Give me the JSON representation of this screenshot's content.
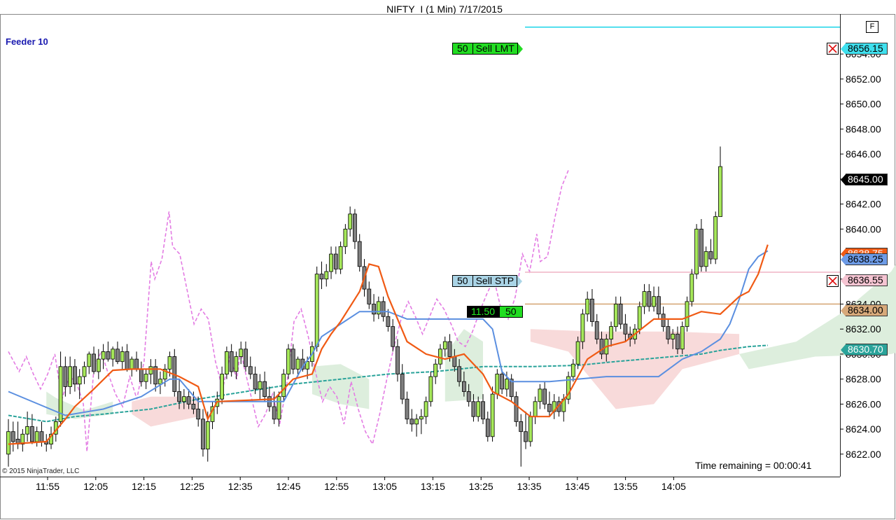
{
  "window": {
    "title": "NIFTY_I (1 Min)  7/17/2015",
    "f_button": "F",
    "feeder": "Feeder 10",
    "copyright": "© 2015 NinjaTrader, LLC",
    "time_remaining": "Time remaining = 00:00:41"
  },
  "orders": {
    "limit": {
      "qty": "50",
      "label": "Sell LMT",
      "price": "8656.15"
    },
    "stop": {
      "qty": "50",
      "label": "Sell STP",
      "price": "8636.55"
    }
  },
  "position": {
    "pnl": "11.50",
    "qty": "50",
    "entry_price": "8634.00"
  },
  "price_labels": {
    "last": "8645.00",
    "orange": "8638.75",
    "blue": "8638.25",
    "teal": "8630.70"
  },
  "colors": {
    "up_candle": "#a6e85a",
    "down_candle": "#808080",
    "limit_line": "#1ad4e8",
    "stop_line": "#f0b8c8",
    "entry_line": "#d7a97a",
    "orange_line": "#f05a14",
    "blue_line": "#5b8fe0",
    "teal_line": "#2aa39a",
    "magenta_line": "#e37ce3"
  },
  "chart_data": {
    "type": "candlestick",
    "x_ticks": [
      "11:55",
      "12:05",
      "12:15",
      "12:25",
      "12:35",
      "12:45",
      "12:55",
      "13:05",
      "13:15",
      "13:25",
      "13:35",
      "13:45",
      "13:55",
      "14:05"
    ],
    "y_ticks": [
      "8622.00",
      "8624.00",
      "8626.00",
      "8628.00",
      "8630.00",
      "8632.00",
      "8634.00",
      "8636.00",
      "8638.00",
      "8640.00",
      "8642.00",
      "8644.00",
      "8646.00",
      "8648.00",
      "8650.00",
      "8652.00",
      "8654.00"
    ],
    "ylim": [
      8620.2,
      8657.2
    ],
    "candles": [
      [
        8622.0,
        8624.8,
        8621.0,
        8623.8
      ],
      [
        8623.8,
        8624.6,
        8622.2,
        8623.0
      ],
      [
        8623.2,
        8624.6,
        8622.4,
        8622.8
      ],
      [
        8622.8,
        8624.0,
        8622.2,
        8623.6
      ],
      [
        8623.6,
        8625.4,
        8623.0,
        8624.2
      ],
      [
        8624.2,
        8625.2,
        8622.8,
        8623.0
      ],
      [
        8623.0,
        8624.2,
        8622.6,
        8623.8
      ],
      [
        8623.8,
        8624.6,
        8622.6,
        8623.0
      ],
      [
        8623.0,
        8623.6,
        8622.2,
        8622.8
      ],
      [
        8622.8,
        8624.2,
        8622.4,
        8623.6
      ],
      [
        8623.6,
        8625.0,
        8623.0,
        8624.6
      ],
      [
        8624.6,
        8630.2,
        8624.2,
        8629.0
      ],
      [
        8629.0,
        8629.8,
        8626.6,
        8627.4
      ],
      [
        8627.4,
        8629.8,
        8626.8,
        8629.0
      ],
      [
        8629.0,
        8629.6,
        8627.0,
        8627.6
      ],
      [
        8627.6,
        8628.8,
        8626.4,
        8628.2
      ],
      [
        8628.2,
        8629.4,
        8627.6,
        8629.0
      ],
      [
        8629.0,
        8630.2,
        8628.4,
        8630.0
      ],
      [
        8630.0,
        8630.6,
        8628.4,
        8628.6
      ],
      [
        8628.6,
        8630.4,
        8628.0,
        8629.6
      ],
      [
        8629.6,
        8630.8,
        8628.8,
        8630.2
      ],
      [
        8630.2,
        8631.0,
        8629.4,
        8629.6
      ],
      [
        8629.6,
        8630.6,
        8629.0,
        8630.4
      ],
      [
        8630.4,
        8631.0,
        8629.2,
        8629.4
      ],
      [
        8629.4,
        8630.6,
        8628.8,
        8630.2
      ],
      [
        8630.2,
        8630.8,
        8628.6,
        8628.8
      ],
      [
        8628.8,
        8629.8,
        8628.2,
        8629.6
      ],
      [
        8629.6,
        8630.2,
        8628.6,
        8628.8
      ],
      [
        8628.8,
        8629.4,
        8627.4,
        8627.8
      ],
      [
        8627.8,
        8628.8,
        8627.2,
        8628.4
      ],
      [
        8628.4,
        8629.6,
        8627.6,
        8629.0
      ],
      [
        8629.0,
        8629.6,
        8627.0,
        8627.6
      ],
      [
        8627.6,
        8628.6,
        8626.8,
        8628.0
      ],
      [
        8628.0,
        8629.2,
        8627.4,
        8628.8
      ],
      [
        8628.8,
        8630.2,
        8628.2,
        8629.8
      ],
      [
        8629.8,
        8630.4,
        8626.6,
        8627.0
      ],
      [
        8627.0,
        8628.0,
        8625.6,
        8626.2
      ],
      [
        8626.2,
        8627.2,
        8625.6,
        8626.6
      ],
      [
        8626.6,
        8627.2,
        8625.6,
        8626.0
      ],
      [
        8626.0,
        8627.0,
        8625.2,
        8625.6
      ],
      [
        8625.6,
        8626.6,
        8624.2,
        8624.8
      ],
      [
        8624.8,
        8625.6,
        8621.8,
        8622.4
      ],
      [
        8622.4,
        8625.4,
        8621.4,
        8624.6
      ],
      [
        8624.6,
        8626.2,
        8624.0,
        8625.8
      ],
      [
        8625.8,
        8627.0,
        8625.2,
        8626.4
      ],
      [
        8626.4,
        8629.0,
        8626.0,
        8628.4
      ],
      [
        8628.4,
        8630.6,
        8628.0,
        8630.2
      ],
      [
        8630.2,
        8630.8,
        8628.2,
        8628.6
      ],
      [
        8628.6,
        8630.2,
        8628.0,
        8629.8
      ],
      [
        8629.8,
        8631.0,
        8629.2,
        8630.4
      ],
      [
        8630.4,
        8631.0,
        8628.6,
        8629.0
      ],
      [
        8629.0,
        8629.8,
        8628.0,
        8628.4
      ],
      [
        8628.4,
        8629.0,
        8626.8,
        8627.2
      ],
      [
        8627.2,
        8628.4,
        8626.4,
        8627.8
      ],
      [
        8627.8,
        8628.6,
        8626.2,
        8626.6
      ],
      [
        8626.6,
        8627.4,
        8625.4,
        8625.8
      ],
      [
        8625.8,
        8627.0,
        8624.4,
        8624.8
      ],
      [
        8624.8,
        8627.0,
        8624.2,
        8626.6
      ],
      [
        8626.6,
        8628.8,
        8626.2,
        8628.4
      ],
      [
        8628.4,
        8630.8,
        8628.0,
        8630.4
      ],
      [
        8630.4,
        8630.8,
        8628.4,
        8628.8
      ],
      [
        8628.8,
        8629.8,
        8628.2,
        8629.6
      ],
      [
        8629.6,
        8630.4,
        8628.6,
        8628.8
      ],
      [
        8628.8,
        8629.8,
        8628.0,
        8629.4
      ],
      [
        8629.4,
        8631.0,
        8629.0,
        8630.6
      ],
      [
        8630.6,
        8637.0,
        8630.2,
        8636.4
      ],
      [
        8636.4,
        8637.4,
        8635.2,
        8636.0
      ],
      [
        8636.0,
        8637.2,
        8635.4,
        8636.6
      ],
      [
        8636.6,
        8638.6,
        8636.0,
        8638.0
      ],
      [
        8638.0,
        8638.6,
        8636.4,
        8636.8
      ],
      [
        8636.8,
        8639.0,
        8636.4,
        8638.6
      ],
      [
        8638.6,
        8640.4,
        8638.0,
        8640.0
      ],
      [
        8640.0,
        8641.8,
        8639.4,
        8641.2
      ],
      [
        8641.2,
        8641.6,
        8638.4,
        8639.0
      ],
      [
        8639.0,
        8639.6,
        8636.6,
        8637.0
      ],
      [
        8637.0,
        8637.6,
        8634.6,
        8635.2
      ],
      [
        8635.2,
        8635.8,
        8633.6,
        8634.0
      ],
      [
        8634.0,
        8634.8,
        8632.6,
        8633.2
      ],
      [
        8633.2,
        8634.6,
        8632.8,
        8634.2
      ],
      [
        8634.2,
        8634.6,
        8632.6,
        8633.0
      ],
      [
        8633.0,
        8633.6,
        8631.8,
        8632.2
      ],
      [
        8632.2,
        8632.8,
        8630.2,
        8630.6
      ],
      [
        8630.6,
        8631.2,
        8627.8,
        8628.4
      ],
      [
        8628.4,
        8629.2,
        8626.0,
        8626.4
      ],
      [
        8626.4,
        8627.0,
        8624.4,
        8624.8
      ],
      [
        8624.8,
        8625.6,
        8623.8,
        8624.4
      ],
      [
        8624.4,
        8625.2,
        8623.4,
        8624.8
      ],
      [
        8624.8,
        8625.6,
        8623.6,
        8625.0
      ],
      [
        8625.0,
        8626.6,
        8624.4,
        8626.2
      ],
      [
        8626.2,
        8628.6,
        8625.8,
        8628.2
      ],
      [
        8628.2,
        8629.6,
        8627.6,
        8629.2
      ],
      [
        8629.2,
        8630.8,
        8628.8,
        8630.4
      ],
      [
        8630.4,
        8631.4,
        8629.8,
        8631.0
      ],
      [
        8631.0,
        8631.6,
        8629.4,
        8629.8
      ],
      [
        8629.8,
        8630.4,
        8628.6,
        8629.0
      ],
      [
        8629.0,
        8629.6,
        8627.4,
        8627.8
      ],
      [
        8627.8,
        8628.6,
        8626.6,
        8627.0
      ],
      [
        8627.0,
        8627.6,
        8625.8,
        8626.2
      ],
      [
        8626.2,
        8626.8,
        8624.6,
        8625.0
      ],
      [
        8625.0,
        8626.6,
        8624.6,
        8626.2
      ],
      [
        8626.2,
        8626.8,
        8624.4,
        8624.8
      ],
      [
        8624.8,
        8625.4,
        8623.0,
        8623.4
      ],
      [
        8623.4,
        8627.4,
        8623.0,
        8626.8
      ],
      [
        8626.8,
        8628.8,
        8626.4,
        8628.4
      ],
      [
        8628.4,
        8628.8,
        8626.8,
        8627.2
      ],
      [
        8627.2,
        8628.6,
        8626.6,
        8628.0
      ],
      [
        8628.0,
        8628.4,
        8626.2,
        8626.6
      ],
      [
        8626.6,
        8627.0,
        8624.2,
        8624.6
      ],
      [
        8624.6,
        8625.2,
        8621.0,
        8623.8
      ],
      [
        8623.8,
        8625.4,
        8622.4,
        8623.0
      ],
      [
        8623.0,
        8625.4,
        8622.6,
        8625.0
      ],
      [
        8625.0,
        8626.6,
        8624.4,
        8626.2
      ],
      [
        8626.2,
        8627.6,
        8625.6,
        8627.2
      ],
      [
        8627.2,
        8627.8,
        8625.6,
        8626.0
      ],
      [
        8626.0,
        8627.0,
        8625.0,
        8625.4
      ],
      [
        8625.4,
        8626.8,
        8624.8,
        8626.2
      ],
      [
        8626.2,
        8626.6,
        8625.0,
        8625.4
      ],
      [
        8625.4,
        8626.8,
        8624.6,
        8626.4
      ],
      [
        8626.4,
        8628.6,
        8626.0,
        8628.2
      ],
      [
        8628.2,
        8629.6,
        8627.8,
        8629.2
      ],
      [
        8629.2,
        8631.4,
        8628.8,
        8631.0
      ],
      [
        8631.0,
        8633.6,
        8630.4,
        8633.2
      ],
      [
        8633.2,
        8635.0,
        8632.6,
        8634.4
      ],
      [
        8634.4,
        8635.2,
        8632.2,
        8632.6
      ],
      [
        8632.6,
        8633.2,
        8630.8,
        8631.2
      ],
      [
        8631.2,
        8631.8,
        8629.6,
        8630.0
      ],
      [
        8630.0,
        8631.6,
        8629.4,
        8631.2
      ],
      [
        8631.2,
        8632.6,
        8630.6,
        8632.2
      ],
      [
        8632.2,
        8634.6,
        8631.8,
        8634.0
      ],
      [
        8634.0,
        8634.6,
        8632.0,
        8632.4
      ],
      [
        8632.4,
        8633.2,
        8631.0,
        8631.6
      ],
      [
        8631.6,
        8632.2,
        8630.6,
        8631.2
      ],
      [
        8631.2,
        8632.4,
        8630.8,
        8632.0
      ],
      [
        8632.0,
        8634.2,
        8631.6,
        8633.8
      ],
      [
        8633.8,
        8635.6,
        8633.2,
        8635.0
      ],
      [
        8635.0,
        8635.6,
        8633.4,
        8633.8
      ],
      [
        8633.8,
        8635.4,
        8633.4,
        8634.6
      ],
      [
        8634.6,
        8635.4,
        8632.8,
        8633.2
      ],
      [
        8633.2,
        8633.8,
        8631.8,
        8632.2
      ],
      [
        8632.2,
        8632.8,
        8630.8,
        8631.2
      ],
      [
        8631.2,
        8632.0,
        8630.4,
        8631.6
      ],
      [
        8631.6,
        8632.2,
        8630.0,
        8630.4
      ],
      [
        8630.4,
        8632.6,
        8630.0,
        8632.2
      ],
      [
        8632.2,
        8634.6,
        8631.8,
        8634.2
      ],
      [
        8634.2,
        8636.8,
        8633.8,
        8636.4
      ],
      [
        8636.4,
        8640.4,
        8636.0,
        8640.0
      ],
      [
        8640.0,
        8640.8,
        8636.6,
        8637.0
      ],
      [
        8637.0,
        8638.6,
        8636.6,
        8638.2
      ],
      [
        8638.2,
        8639.2,
        8637.2,
        8637.6
      ],
      [
        8637.6,
        8641.4,
        8637.2,
        8641.0
      ],
      [
        8641.0,
        8646.6,
        8641.2,
        8645.0
      ]
    ],
    "blue_line": [
      [
        0,
        8627.0
      ],
      [
        12,
        8625.1
      ],
      [
        20,
        8625.6
      ],
      [
        28,
        8626.6
      ],
      [
        34,
        8628.0
      ],
      [
        36,
        8628.0
      ],
      [
        40,
        8626.2
      ],
      [
        52,
        8626.2
      ],
      [
        58,
        8626.2
      ],
      [
        62,
        8629.0
      ],
      [
        64,
        8630.0
      ],
      [
        66,
        8631.4
      ],
      [
        70,
        8632.4
      ],
      [
        74,
        8633.4
      ],
      [
        80,
        8633.4
      ],
      [
        84,
        8632.8
      ],
      [
        90,
        8632.8
      ],
      [
        100,
        8632.8
      ],
      [
        102,
        8632.0
      ],
      [
        104,
        8628.6
      ],
      [
        106,
        8627.8
      ],
      [
        114,
        8627.8
      ],
      [
        126,
        8628.2
      ],
      [
        137,
        8628.2
      ],
      [
        142,
        8629.6
      ],
      [
        146,
        8630.2
      ],
      [
        150,
        8631.2
      ],
      [
        152,
        8632.4
      ],
      [
        154,
        8634.4
      ],
      [
        156,
        8636.8
      ],
      [
        158,
        8637.8
      ],
      [
        160,
        8638.25
      ]
    ],
    "orange_line": [
      [
        0,
        8622.8
      ],
      [
        8,
        8623.0
      ],
      [
        12,
        8624.8
      ],
      [
        14,
        8625.8
      ],
      [
        18,
        8627.2
      ],
      [
        22,
        8628.7
      ],
      [
        26,
        8628.8
      ],
      [
        32,
        8628.8
      ],
      [
        36,
        8628.2
      ],
      [
        40,
        8627.4
      ],
      [
        42,
        8624.8
      ],
      [
        44,
        8626.2
      ],
      [
        56,
        8626.4
      ],
      [
        60,
        8628.0
      ],
      [
        64,
        8628.4
      ],
      [
        66,
        8630.4
      ],
      [
        68,
        8631.6
      ],
      [
        70,
        8632.6
      ],
      [
        74,
        8635.0
      ],
      [
        76,
        8637.2
      ],
      [
        78,
        8637.0
      ],
      [
        80,
        8634.6
      ],
      [
        84,
        8631.0
      ],
      [
        88,
        8630.0
      ],
      [
        92,
        8629.6
      ],
      [
        96,
        8630.0
      ],
      [
        100,
        8628.4
      ],
      [
        102,
        8627.0
      ],
      [
        106,
        8626.2
      ],
      [
        110,
        8625.0
      ],
      [
        114,
        8625.0
      ],
      [
        118,
        8626.8
      ],
      [
        122,
        8629.6
      ],
      [
        126,
        8630.6
      ],
      [
        130,
        8631.0
      ],
      [
        134,
        8632.2
      ],
      [
        136,
        8632.8
      ],
      [
        142,
        8632.8
      ],
      [
        146,
        8633.4
      ],
      [
        150,
        8633.2
      ],
      [
        154,
        8634.6
      ],
      [
        156,
        8635.0
      ],
      [
        158,
        8636.4
      ],
      [
        160,
        8638.75
      ]
    ],
    "teal_line": [
      [
        0,
        8625.1
      ],
      [
        8,
        8624.6
      ],
      [
        14,
        8625.0
      ],
      [
        20,
        8625.2
      ],
      [
        30,
        8625.6
      ],
      [
        40,
        8626.4
      ],
      [
        50,
        8627.0
      ],
      [
        60,
        8627.6
      ],
      [
        70,
        8628.0
      ],
      [
        80,
        8628.4
      ],
      [
        90,
        8628.6
      ],
      [
        100,
        8629.0
      ],
      [
        110,
        8629.0
      ],
      [
        120,
        8629.1
      ],
      [
        128,
        8629.4
      ],
      [
        134,
        8629.6
      ],
      [
        140,
        8629.8
      ],
      [
        146,
        8630.0
      ],
      [
        150,
        8630.3
      ],
      [
        156,
        8630.6
      ],
      [
        160,
        8630.7
      ]
    ]
  }
}
